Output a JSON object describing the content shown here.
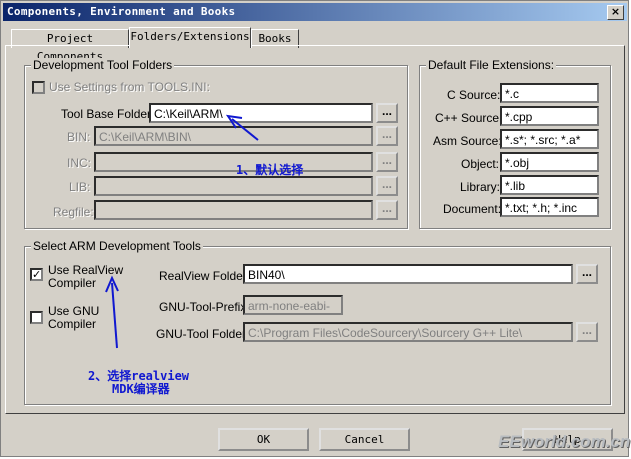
{
  "window": {
    "title": "Components, Environment and Books",
    "close_glyph": "×"
  },
  "tabs": [
    "Project Components",
    "Folders/Extensions",
    "Books"
  ],
  "dev_tools": {
    "group_label": "Development Tool Folders",
    "use_settings_label": "Use Settings from TOOLS.INI:",
    "tool_base_label": "Tool Base Folder:",
    "tool_base_value": "C:\\Keil\\ARM\\",
    "bin_label": "BIN:",
    "bin_value": "C:\\Keil\\ARM\\BIN\\",
    "inc_label": "INC:",
    "lib_label": "LIB:",
    "regfile_label": "Regfile:",
    "browse_label": "..."
  },
  "extensions": {
    "group_label": "Default File Extensions:",
    "items": [
      {
        "label": "C Source:",
        "value": "*.c"
      },
      {
        "label": "C++ Source:",
        "value": "*.cpp"
      },
      {
        "label": "Asm Source:",
        "value": "*.s*; *.src; *.a*"
      },
      {
        "label": "Object:",
        "value": "*.obj"
      },
      {
        "label": "Library:",
        "value": "*.lib"
      },
      {
        "label": "Document:",
        "value": "*.txt; *.h; *.inc"
      }
    ]
  },
  "arm_tools": {
    "group_label": "Select ARM Development Tools",
    "use_realview_line1": "Use RealView",
    "use_realview_line2": "Compiler",
    "use_gnu_line1": "Use GNU",
    "use_gnu_line2": "Compiler",
    "realview_folder_label": "RealView Folder:",
    "realview_folder_value": "BIN40\\",
    "gnu_prefix_label": "GNU-Tool-Prefix:",
    "gnu_prefix_value": "arm-none-eabi-",
    "gnu_folder_label": "GNU-Tool Folder:",
    "gnu_folder_value": "C:\\Program Files\\CodeSourcery\\Sourcery G++ Lite\\",
    "realview_checked": true,
    "gnu_checked": false
  },
  "annotations": {
    "note1": "1、默认选择",
    "note2_line1": "2、选择realview",
    "note2_line2": "MDK编译器",
    "color": "#1018d0"
  },
  "buttons": {
    "ok": "OK",
    "cancel": "Cancel",
    "help": "Help"
  },
  "watermark": "EEworld.com.cn"
}
